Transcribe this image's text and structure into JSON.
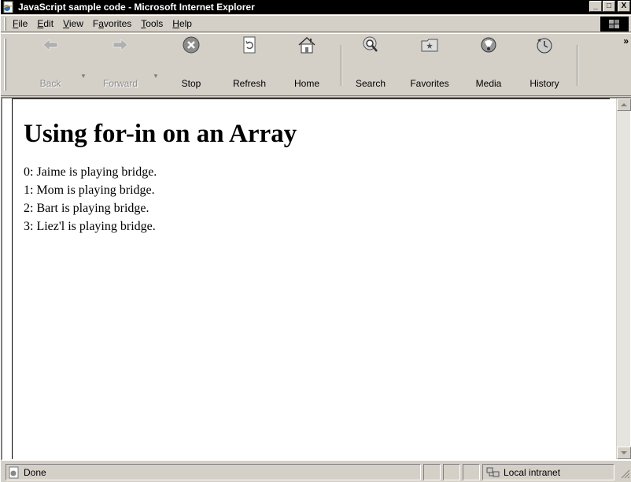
{
  "window": {
    "title": "JavaScript sample code - Microsoft Internet Explorer",
    "controls": {
      "minimize": "_",
      "maximize": "□",
      "close": "X"
    }
  },
  "menubar": {
    "items": [
      {
        "label": "File",
        "access_key": "F"
      },
      {
        "label": "Edit",
        "access_key": "E"
      },
      {
        "label": "View",
        "access_key": "V"
      },
      {
        "label": "Favorites",
        "access_key": "a"
      },
      {
        "label": "Tools",
        "access_key": "T"
      },
      {
        "label": "Help",
        "access_key": "H"
      }
    ]
  },
  "toolbar": {
    "back": {
      "label": "Back",
      "icon": "back-arrow-icon",
      "enabled": false
    },
    "forward": {
      "label": "Forward",
      "icon": "forward-arrow-icon",
      "enabled": false
    },
    "stop": {
      "label": "Stop",
      "icon": "stop-icon"
    },
    "refresh": {
      "label": "Refresh",
      "icon": "refresh-icon"
    },
    "home": {
      "label": "Home",
      "icon": "home-icon"
    },
    "search": {
      "label": "Search",
      "icon": "search-icon"
    },
    "favorites": {
      "label": "Favorites",
      "icon": "favorites-icon"
    },
    "media": {
      "label": "Media",
      "icon": "media-icon"
    },
    "history": {
      "label": "History",
      "icon": "history-icon"
    },
    "overflow": "»"
  },
  "content": {
    "heading": "Using for-in on an Array",
    "lines": [
      "0: Jaime is playing bridge.",
      "1: Mom is playing bridge.",
      "2: Bart is playing bridge.",
      "3: Liez'l is playing bridge."
    ]
  },
  "statusbar": {
    "status": "Done",
    "zone": "Local intranet"
  },
  "colors": {
    "chrome": "#d4d0c8",
    "titlebar": "#000000",
    "content_bg": "#ffffff"
  }
}
